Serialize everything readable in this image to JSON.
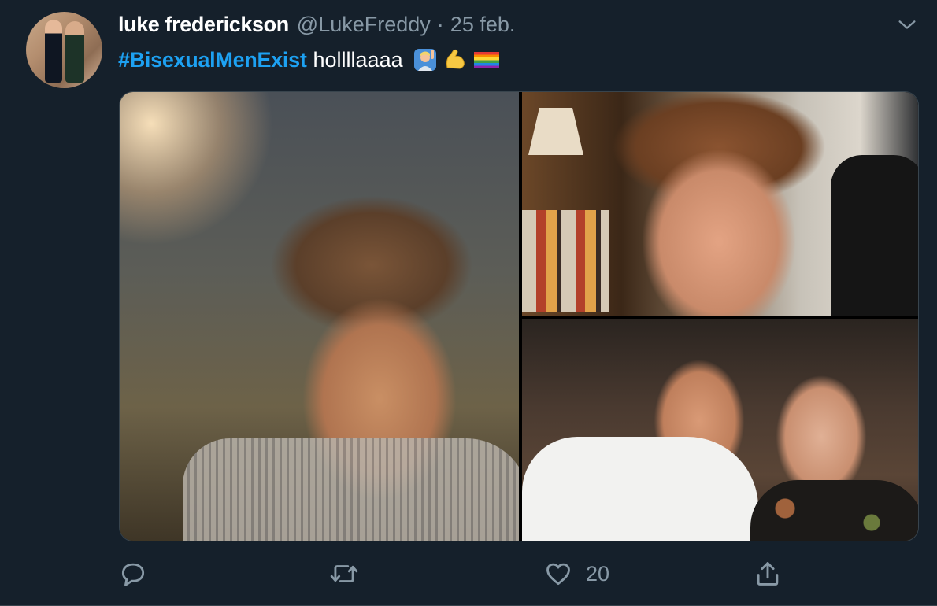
{
  "tweet": {
    "author": {
      "name": "luke frederickson",
      "handle": "@LukeFreddy"
    },
    "separator": "·",
    "date": "25 feb.",
    "hashtag": "#BisexualMenExist",
    "text": "hollllaaaa",
    "emojis": [
      "raising-hand-icon",
      "flexed-biceps-icon",
      "rainbow-flag-icon"
    ],
    "media_count": 3,
    "actions": {
      "reply_count": "",
      "retweet_count": "",
      "like_count": "20"
    }
  },
  "colors": {
    "background": "#15202b",
    "secondary_text": "#8899a6",
    "hashtag": "#1da1f2",
    "border": "#38444d"
  }
}
